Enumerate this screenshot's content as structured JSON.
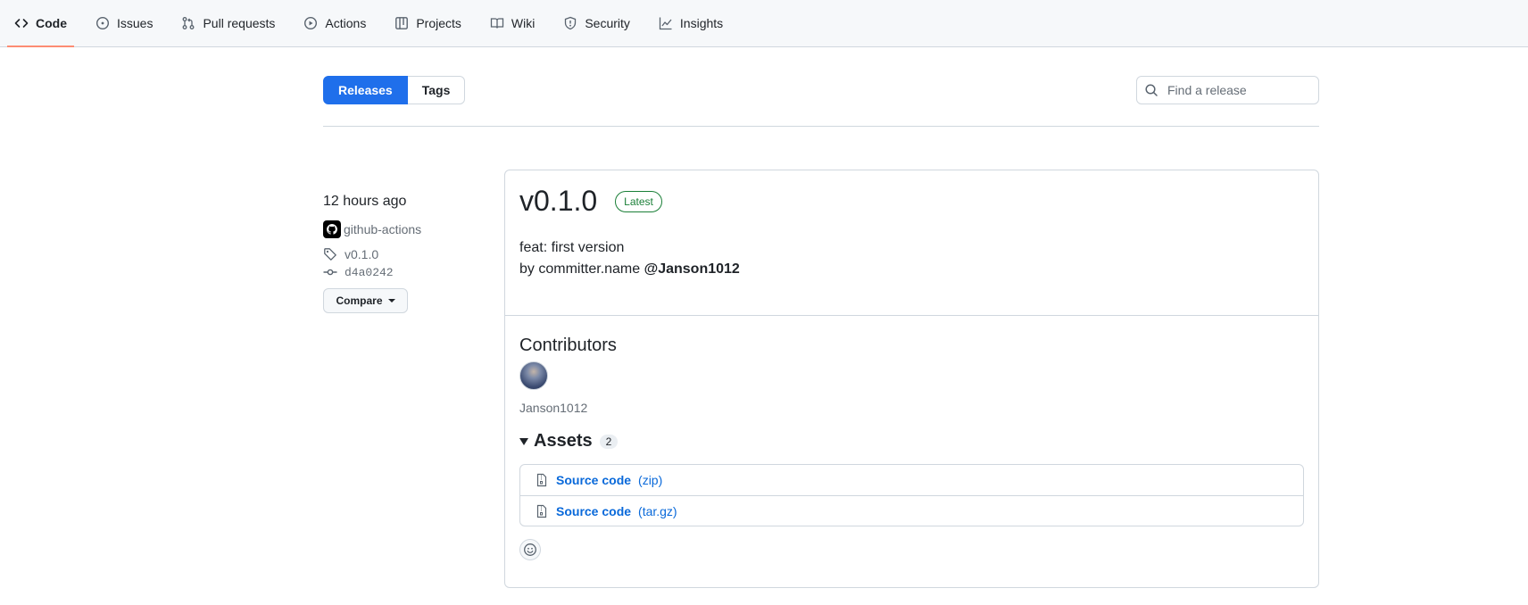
{
  "repo_nav": {
    "items": [
      {
        "label": "Code",
        "icon": "code-icon",
        "active": true
      },
      {
        "label": "Issues",
        "icon": "issue-opened-icon"
      },
      {
        "label": "Pull requests",
        "icon": "git-pull-request-icon"
      },
      {
        "label": "Actions",
        "icon": "play-icon"
      },
      {
        "label": "Projects",
        "icon": "table-icon"
      },
      {
        "label": "Wiki",
        "icon": "book-icon"
      },
      {
        "label": "Security",
        "icon": "shield-icon"
      },
      {
        "label": "Insights",
        "icon": "graph-icon"
      }
    ]
  },
  "subnav": {
    "releases_label": "Releases",
    "tags_label": "Tags",
    "search_placeholder": "Find a release"
  },
  "release": {
    "time_ago": "12 hours ago",
    "author": "github-actions",
    "tag": "v0.1.0",
    "commit": "d4a0242",
    "compare_label": "Compare",
    "title": "v0.1.0",
    "badge": "Latest",
    "body_line1": "feat: first version",
    "body_line2_prefix": "by committer.name",
    "body_mention": "@Janson1012",
    "contributors_heading": "Contributors",
    "contributor_name": "Janson1012",
    "assets_heading": "Assets",
    "assets_count": "2",
    "assets": [
      {
        "name": "Source code",
        "ext": "(zip)"
      },
      {
        "name": "Source code",
        "ext": "(tar.gz)"
      }
    ]
  },
  "colors": {
    "accent": "#1f6feb",
    "link": "#0969da",
    "latest_green": "#1a7f37",
    "active_underline": "#fd8c73"
  }
}
